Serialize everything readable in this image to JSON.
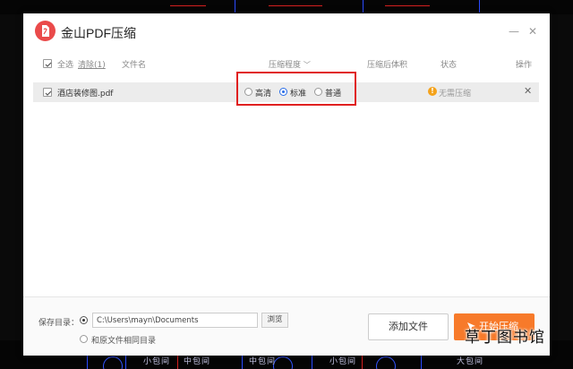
{
  "app": {
    "title": "金山PDF压缩",
    "brand_color": "#ea4a4a"
  },
  "header": {
    "select_all": "全选",
    "clear": "清除(1)",
    "filename": "文件名",
    "compression_level": "压缩程度",
    "size_after": "压缩后体积",
    "status": "状态",
    "action": "操作"
  },
  "files": [
    {
      "name": "酒店装修图.pdf",
      "options": [
        "高清",
        "标准",
        "普通"
      ],
      "selected_option": "标准",
      "status": "无需压缩"
    }
  ],
  "footer": {
    "save_label": "保存目录：",
    "path": "C:\\Users\\mayn\\Documents",
    "browse": "浏览",
    "same_dir": "和原文件相同目录",
    "add_file": "添加文件",
    "start": "开始压缩"
  },
  "background_text": [
    "小包间",
    "中包间",
    "中包间",
    "小包间",
    "大包间"
  ],
  "watermark": "草丁图书馆",
  "colors": {
    "accent": "#f77a2a",
    "radio_selected": "#2b6ee8",
    "warning": "#f4a21a",
    "highlight_box": "#e02020"
  }
}
